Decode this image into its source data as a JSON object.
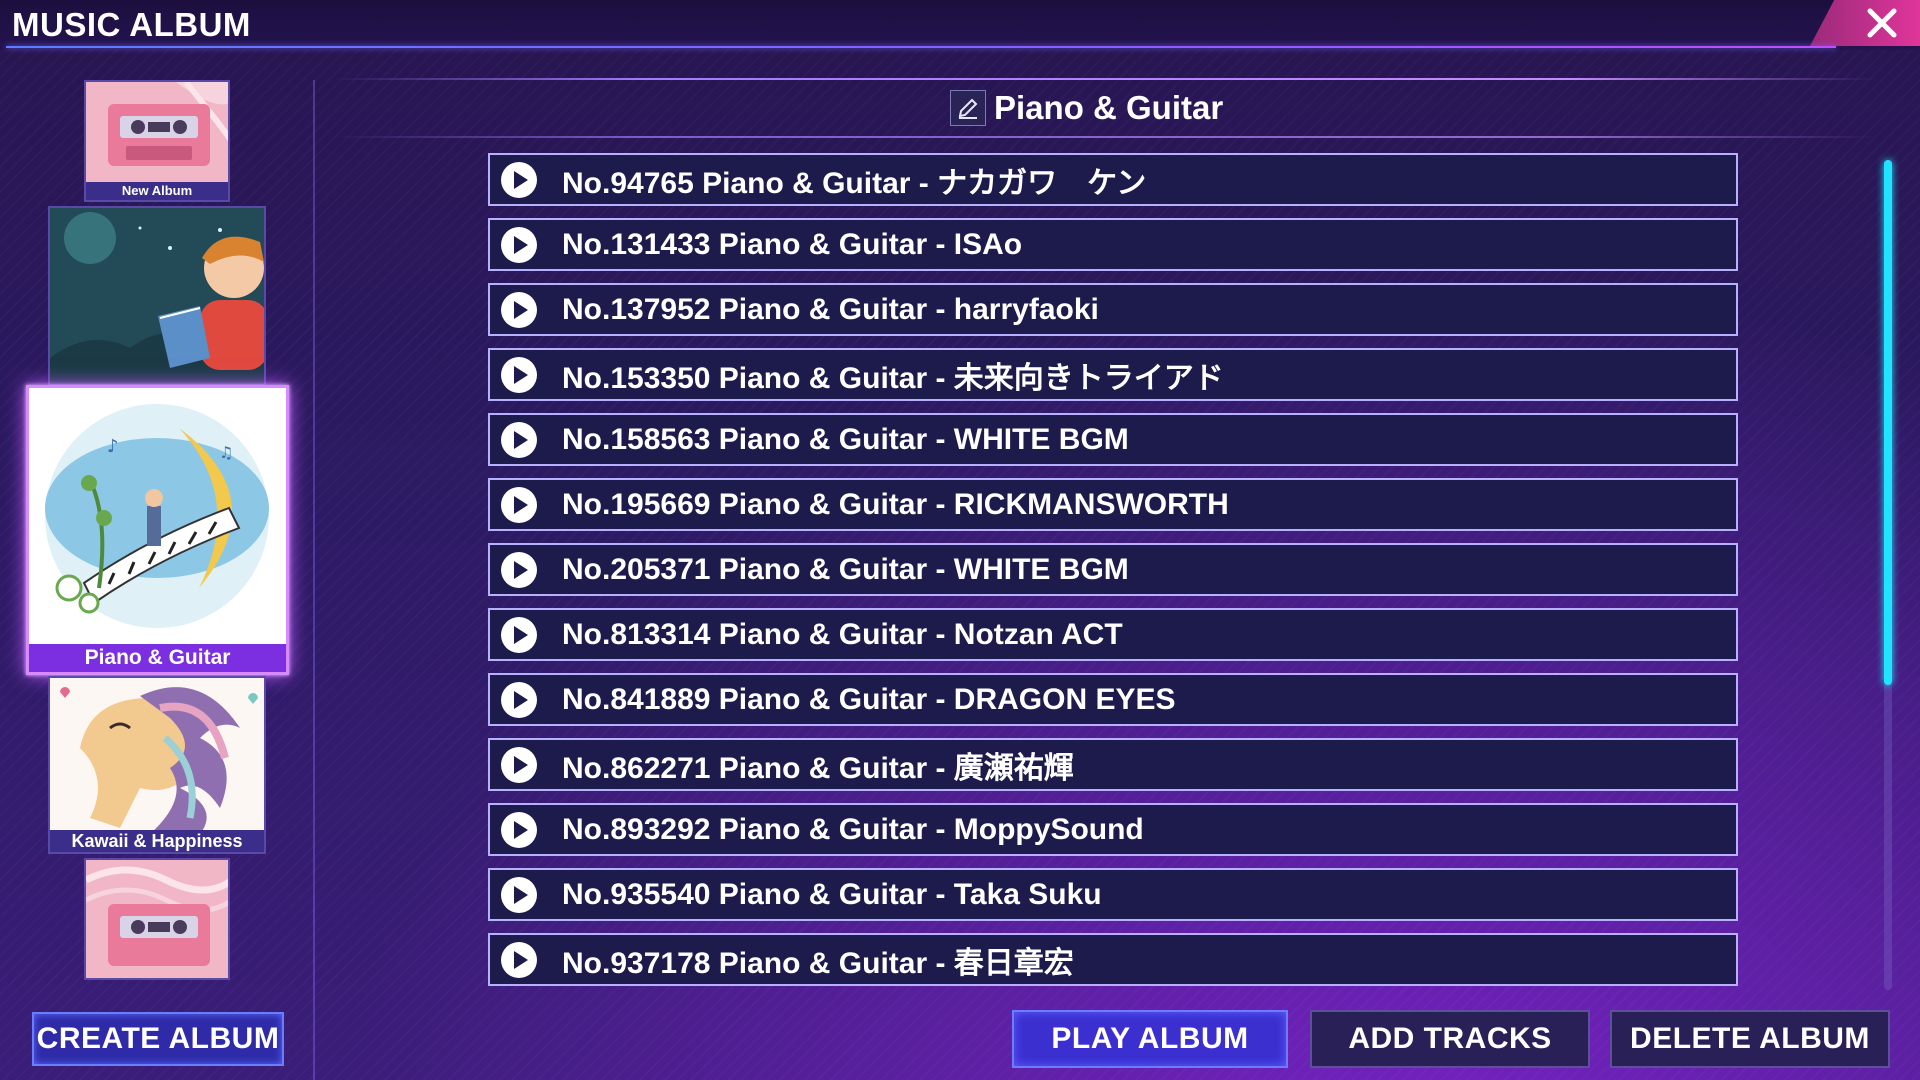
{
  "app": {
    "title": "MUSIC ALBUM",
    "accent_color": "#e0359a",
    "highlight_color": "#20e4ff"
  },
  "sidebar": {
    "albums": [
      {
        "label": "New Album",
        "cover": "cassette-art",
        "state": "default"
      },
      {
        "label": "",
        "cover": "boy-reading-art",
        "state": "default"
      },
      {
        "label": "Piano & Guitar",
        "cover": "piano-moon-art",
        "state": "selected"
      },
      {
        "label": "Kawaii & Happiness",
        "cover": "unicorn-art",
        "state": "default"
      },
      {
        "label": "",
        "cover": "cassette-art",
        "state": "default"
      }
    ],
    "create_album_label": "CREATE ALBUM"
  },
  "main": {
    "album_title": "Piano & Guitar",
    "edit_icon": "pencil-icon",
    "tracks": [
      {
        "title": "No.94765 Piano & Guitar - ナカガワ　ケン"
      },
      {
        "title": "No.131433 Piano & Guitar - ISAo"
      },
      {
        "title": "No.137952 Piano & Guitar - harryfaoki"
      },
      {
        "title": "No.153350 Piano & Guitar - 未来向きトライアド"
      },
      {
        "title": "No.158563 Piano & Guitar - WHITE BGM"
      },
      {
        "title": "No.195669 Piano & Guitar - RICKMANSWORTH"
      },
      {
        "title": "No.205371 Piano & Guitar - WHITE BGM"
      },
      {
        "title": "No.813314 Piano & Guitar - Notzan ACT"
      },
      {
        "title": "No.841889 Piano & Guitar - DRAGON EYES"
      },
      {
        "title": "No.862271 Piano & Guitar - 廣瀬祐輝"
      },
      {
        "title": "No.893292 Piano & Guitar - MoppySound"
      },
      {
        "title": "No.935540 Piano & Guitar - Taka Suku"
      },
      {
        "title": "No.937178 Piano & Guitar - 春日章宏"
      }
    ]
  },
  "actions": {
    "play_album_label": "PLAY ALBUM",
    "add_tracks_label": "ADD TRACKS",
    "delete_album_label": "DELETE ALBUM"
  }
}
